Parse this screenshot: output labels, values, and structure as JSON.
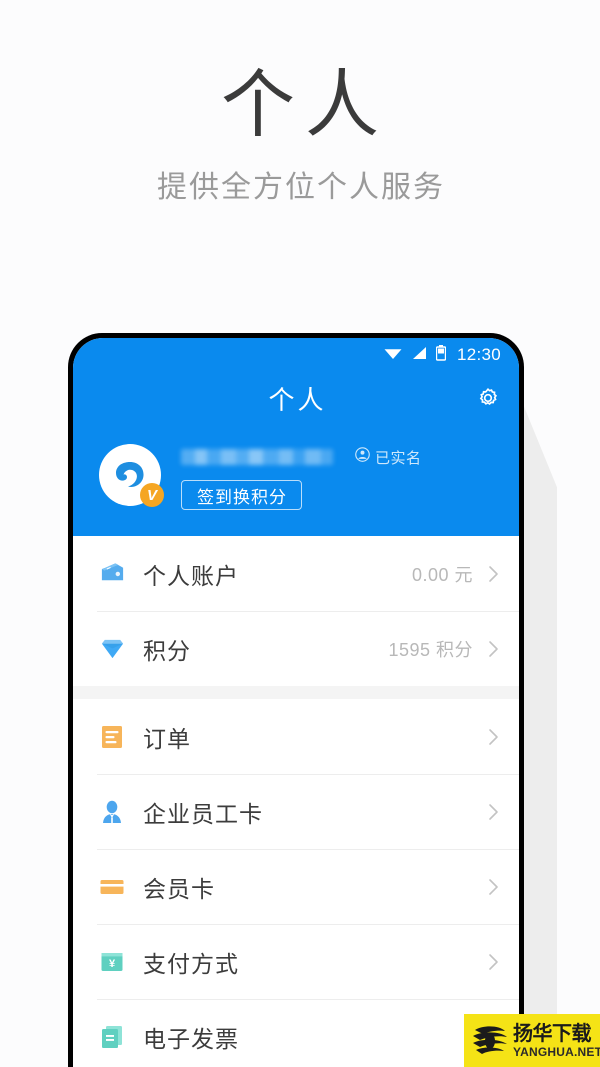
{
  "promo": {
    "title": "个人",
    "subtitle": "提供全方位个人服务"
  },
  "phone": {
    "statusbar": {
      "wifi_icon": "wifi-icon",
      "signal_icon": "signal-icon",
      "battery_icon": "battery-icon",
      "time": "12:30"
    },
    "appbar": {
      "title": "个人",
      "settings_icon": "gear-icon"
    },
    "profile": {
      "avatar_icon": "user-avatar-logo",
      "verified_badge": "V",
      "username_masked": "",
      "verified_icon": "person-circle-icon",
      "verified_label": "已实名",
      "signin_button": "签到换积分"
    },
    "groups": [
      {
        "rows": [
          {
            "icon": "wallet-icon",
            "icon_color": "#4DA6EE",
            "label": "个人账户",
            "value": "0.00 元"
          },
          {
            "icon": "diamond-icon",
            "icon_color": "#3FA9F5",
            "label": "积分",
            "value": "1595 积分"
          }
        ]
      },
      {
        "rows": [
          {
            "icon": "order-document-icon",
            "icon_color": "#F7B55A",
            "label": "订单",
            "value": ""
          },
          {
            "icon": "employee-card-icon",
            "icon_color": "#4DA6EE",
            "label": "企业员工卡",
            "value": ""
          },
          {
            "icon": "membership-card-icon",
            "icon_color": "#F7B55A",
            "label": "会员卡",
            "value": ""
          },
          {
            "icon": "payment-method-icon",
            "icon_color": "#5FD0C0",
            "label": "支付方式",
            "value": ""
          },
          {
            "icon": "e-invoice-icon",
            "icon_color": "#5FD0C0",
            "label": "电子发票",
            "value": ""
          }
        ]
      }
    ]
  },
  "watermark": {
    "logo_icon": "globe-logo-icon",
    "cn": "扬华下载",
    "en": "YANGHUA.NET"
  },
  "colors": {
    "brand_blue": "#0A8AEE",
    "page_bg": "#FCFCFD",
    "watermark_yellow": "#F5E316",
    "badge_orange": "#F5A623"
  }
}
